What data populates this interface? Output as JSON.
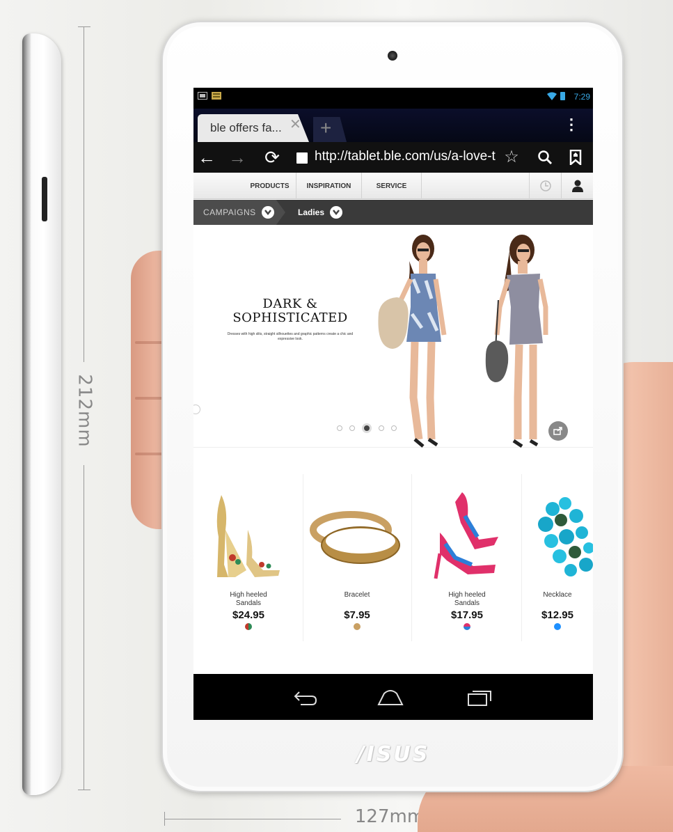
{
  "dimensions": {
    "height_label": "212mm",
    "width_label": "127mm"
  },
  "brand": {
    "logo_text": "/ISUS"
  },
  "status_bar": {
    "time": "7:29"
  },
  "browser": {
    "tab_title": "ble offers fa...",
    "url": "http://tablet.ble.com/us/a-love-t"
  },
  "site_nav": {
    "items": [
      "PRODUCTS",
      "INSPIRATION",
      "SERVICE"
    ]
  },
  "breadcrumb": {
    "campaigns": "CAMPAIGNS",
    "ladies": "Ladies"
  },
  "hero": {
    "title_line1": "DARK &",
    "title_line2": "SOPHISTICATED",
    "subtitle": "Dresses with high slits, straight silhouettes and graphic patterns create a chic and expressive look.",
    "slide_count": 5,
    "active_slide": 3
  },
  "products": [
    {
      "name_line1": "High heeled",
      "name_line2": "Sandals",
      "price": "$24.95",
      "swatches": [
        "#c0392b",
        "#2e8b57"
      ]
    },
    {
      "name_line1": "",
      "name_line2": "Bracelet",
      "price": "$7.95",
      "swatches": [
        "#c9a063"
      ]
    },
    {
      "name_line1": "High heeled",
      "name_line2": "Sandals",
      "price": "$17.95",
      "swatches": [
        "#e0306a",
        "#2d7fd8"
      ]
    },
    {
      "name_line1": "",
      "name_line2": "Necklace",
      "price": "$12.95",
      "swatches": [
        "#1e90ff"
      ]
    }
  ],
  "colors": {
    "status_accent": "#39a9e6",
    "nav_dark": "#3a3a3a",
    "android_bar": "#000000"
  },
  "icons": [
    "back-arrow-icon",
    "forward-arrow-icon",
    "reload-icon",
    "star-icon",
    "search-icon",
    "bookmark-icon",
    "history-icon",
    "account-icon",
    "share-icon",
    "nav-back-icon",
    "nav-home-icon",
    "nav-recents-icon"
  ]
}
